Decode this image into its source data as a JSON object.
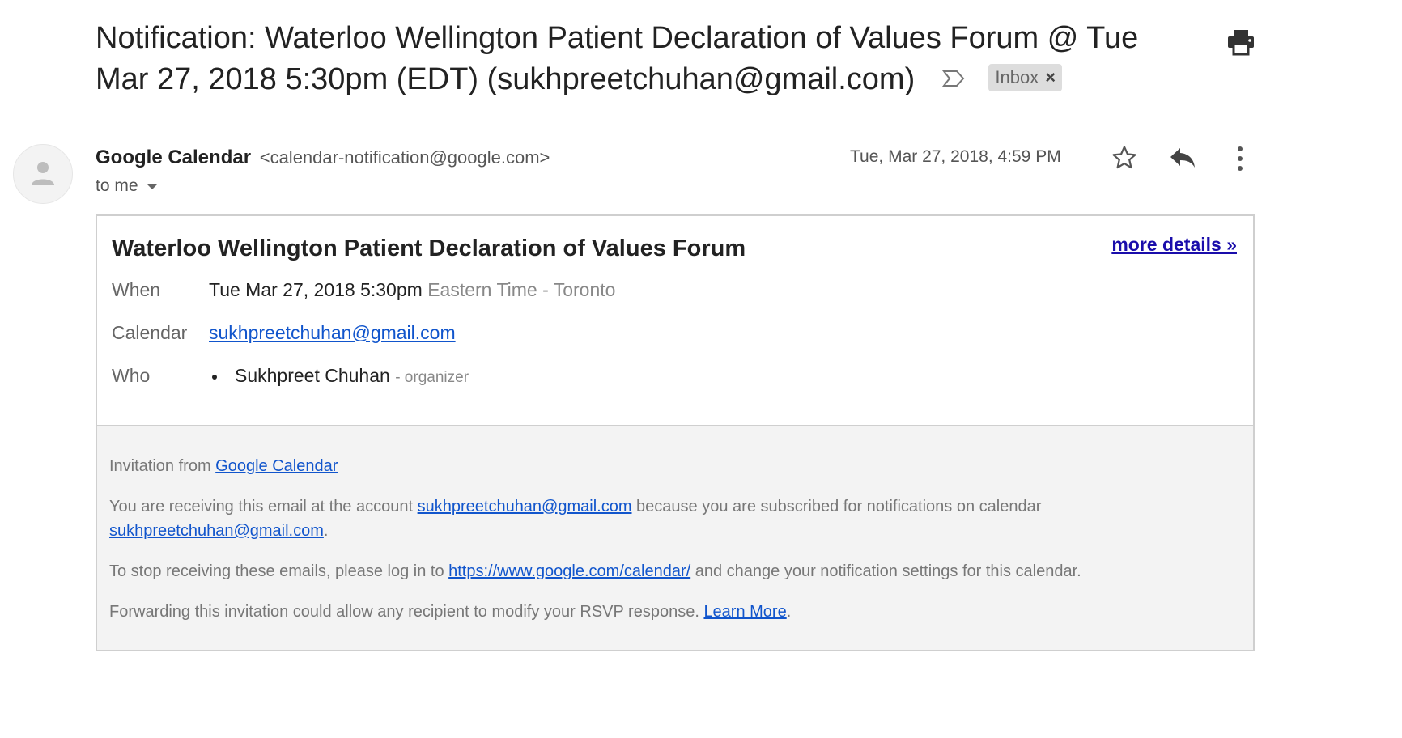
{
  "subject": {
    "text": "Notification: Waterloo Wellington Patient Declaration of Values Forum @ Tue Mar 27, 2018 5:30pm (EDT) (sukhpreetchuhan@gmail.com)",
    "label": "Inbox",
    "label_close": "×"
  },
  "sender": {
    "name": "Google Calendar",
    "address": "<calendar-notification@google.com>",
    "recipient": "to me",
    "date": "Tue, Mar 27, 2018, 4:59 PM"
  },
  "icons": {
    "print": "print-icon",
    "star": "star-icon",
    "reply": "reply-icon",
    "more": "more-vertical-icon",
    "important": "important-marker-icon",
    "avatar": "person-icon"
  },
  "event": {
    "title": "Waterloo Wellington Patient Declaration of Values Forum",
    "more_details": "more details »",
    "when_label": "When",
    "when_value": "Tue Mar 27, 2018 5:30pm",
    "when_timezone": "Eastern Time - Toronto",
    "calendar_label": "Calendar",
    "calendar_value": "sukhpreetchuhan@gmail.com",
    "who_label": "Who",
    "who_name": "Sukhpreet Chuhan",
    "who_role": "- organizer"
  },
  "footer": {
    "invitation_prefix": "Invitation from ",
    "invitation_link": "Google Calendar",
    "receiving_prefix": "You are receiving this email at the account ",
    "receiving_account": "sukhpreetchuhan@gmail.com",
    "receiving_middle": " because you are subscribed for notifications on calendar",
    "receiving_calendar": "sukhpreetchuhan@gmail.com",
    "receiving_suffix": ".",
    "stop_prefix": "To stop receiving these emails, please log in to ",
    "stop_link": "https://www.google.com/calendar/",
    "stop_suffix": " and change your notification settings for this calendar.",
    "forward_prefix": "Forwarding this invitation could allow any recipient to modify your RSVP response. ",
    "forward_link": "Learn More",
    "forward_suffix": "."
  },
  "colors": {
    "link": "#1155cc",
    "more_details_link": "#1a0dab",
    "label_chip_bg": "#dddddd",
    "footer_bg": "#f3f3f3"
  }
}
